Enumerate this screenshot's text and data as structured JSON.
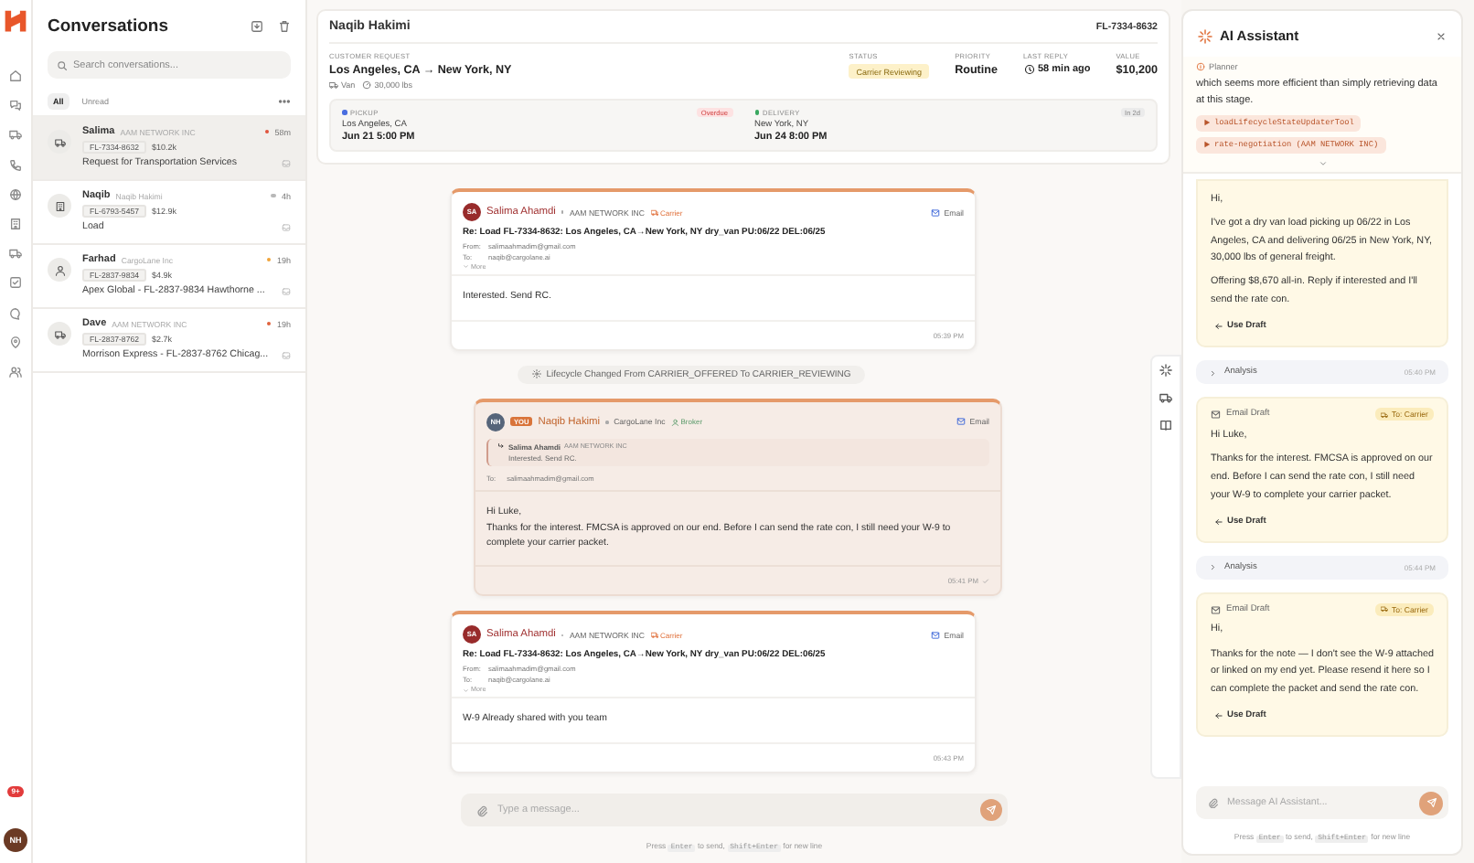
{
  "rail": {
    "badge": "9+",
    "avatar": "NH"
  },
  "conversations": {
    "title": "Conversations",
    "search": {
      "placeholder": "Search conversations..."
    },
    "filters": [
      {
        "label": "All",
        "selected": true
      },
      {
        "label": "Unread",
        "selected": false
      }
    ],
    "items": [
      {
        "kind": "truck",
        "name": "Salima",
        "company": "AAM NETWORK INC",
        "time": "58m",
        "color": "#e0533d",
        "load": "FL-7334-8632",
        "value": "$10.2k",
        "preview": "Request for Transportation Services",
        "selected": true
      },
      {
        "kind": "building",
        "name": "Naqib",
        "company": "Naqib Hakimi",
        "time": "4h",
        "color": "#b8b8b8",
        "load": "FL-6793-5457",
        "value": "$12.9k",
        "preview": "Load",
        "selected": false
      },
      {
        "kind": "person",
        "name": "Farhad",
        "company": "CargoLane Inc",
        "time": "19h",
        "color": "#f0a43a",
        "load": "FL-2837-9834",
        "value": "$4.9k",
        "preview": "Apex Global - FL-2837-9834 Hawthorne ...",
        "selected": false
      },
      {
        "kind": "truck",
        "name": "Dave",
        "company": "AAM NETWORK INC",
        "time": "19h",
        "color": "#e0633d",
        "load": "FL-2837-8762",
        "value": "$2.7k",
        "preview": "Morrison Express - FL-2837-8762 Chicag...",
        "selected": false
      }
    ]
  },
  "load": {
    "name": "Naqib Hakimi",
    "id": "FL-7334-8632",
    "request_label": "CUSTOMER REQUEST",
    "route": "Los Angeles, CA → New York, NY",
    "equipment": "Van",
    "weight": "30,000 lbs",
    "stats": [
      {
        "kind": "status",
        "label": "STATUS",
        "value": "Carrier Reviewing"
      },
      {
        "kind": "text",
        "label": "PRIORITY",
        "value": "Routine"
      },
      {
        "kind": "time",
        "label": "LAST REPLY",
        "value": "58 min ago"
      },
      {
        "kind": "text",
        "label": "VALUE",
        "value": "$10,200"
      }
    ],
    "stops": [
      {
        "kind": "pickup",
        "label": "PICKUP",
        "badge": "Overdue",
        "city": "Los Angeles, CA",
        "date": "Jun 21 5:00 PM"
      },
      {
        "kind": "delivery",
        "label": "DELIVERY",
        "badge": "In 2d",
        "city": "New York, NY",
        "date": "Jun 24 8:00 PM"
      }
    ]
  },
  "thread": [
    {
      "kind": "email",
      "own": false,
      "initials": "SA",
      "sender": "Salima Ahamdi",
      "company": "AAM NETWORK INC",
      "role": "Carrier",
      "channel": "Email",
      "subject": "Re: Load FL-7334-8632: Los Angeles, CA→New York, NY dry_van PU:06/22 DEL:06/25",
      "from_label": "From:",
      "from": "salimaahmadim@gmail.com",
      "to_label": "To:",
      "to": "naqib@cargolane.ai",
      "more": "More",
      "body": [
        "Interested. Send RC."
      ],
      "time": "05:39 PM"
    },
    {
      "kind": "event",
      "text": "Lifecycle Changed From CARRIER_OFFERED To CARRIER_REVIEWING"
    },
    {
      "kind": "email",
      "own": true,
      "you": "YOU",
      "initials": "NH",
      "sender": "Naqib Hakimi",
      "company": "CargoLane Inc",
      "role": "Broker",
      "channel": "Email",
      "quote": {
        "sender": "Salima Ahamdi",
        "company": "AAM NETWORK INC",
        "text": "Interested. Send RC."
      },
      "to_label": "To:",
      "to": "salimaahmadim@gmail.com",
      "body": [
        "Hi Luke,",
        "Thanks for the interest. FMCSA is approved on our end. Before I can send the rate con, I still need your W-9 to complete your carrier packet."
      ],
      "time": "05:41 PM"
    },
    {
      "kind": "email",
      "own": false,
      "initials": "SA",
      "sender": "Salima Ahamdi",
      "company": "AAM NETWORK INC",
      "role": "Carrier",
      "channel": "Email",
      "subject": "Re: Load FL-7334-8632: Los Angeles, CA→New York, NY dry_van PU:06/22 DEL:06/25",
      "from_label": "From:",
      "from": "salimaahmadim@gmail.com",
      "to_label": "To:",
      "to": "naqib@cargolane.ai",
      "more": "More",
      "body": [
        "W-9 Already shared with you team"
      ],
      "time": "05:43 PM"
    }
  ],
  "composer": {
    "placeholder": "Type a message...",
    "hint": [
      {
        "kind": "text",
        "text": "Press"
      },
      {
        "kind": "key",
        "text": "Enter"
      },
      {
        "kind": "text",
        "text": "to send,"
      },
      {
        "kind": "key",
        "text": "Shift+Enter"
      },
      {
        "kind": "text",
        "text": "for new line"
      }
    ]
  },
  "assistant": {
    "title": "AI Assistant",
    "planner": {
      "label": "Planner",
      "text": "which seems more efficient than simply retrieving data at this stage.",
      "tools": [
        "loadLifecycleStateUpdaterTool",
        "rate-negotiation (AAM NETWORK INC)"
      ]
    },
    "feed": [
      {
        "kind": "draft",
        "paragraphs": [
          "Hi,",
          "I've got a dry van load picking up 06/22 in Los Angeles, CA and delivering 06/25 in New York, NY, 30,000 lbs of general freight.",
          "Offering $8,670 all-in. Reply if interested and I'll send the rate con."
        ],
        "action": "Use Draft"
      },
      {
        "kind": "analysis",
        "label": "Analysis",
        "time": "05:40 PM"
      },
      {
        "kind": "draft",
        "label": "Email Draft",
        "tag": "To: Carrier",
        "paragraphs": [
          "Hi Luke,",
          "Thanks for the interest. FMCSA is approved on our end. Before I can send the rate con, I still need your W-9 to complete your carrier packet."
        ],
        "action": "Use Draft"
      },
      {
        "kind": "analysis",
        "label": "Analysis",
        "time": "05:44 PM"
      },
      {
        "kind": "draft",
        "label": "Email Draft",
        "tag": "To: Carrier",
        "paragraphs": [
          "Hi,",
          "Thanks for the note — I don't see the W-9 attached or linked on my end yet. Please resend it here so I can complete the packet and send the rate con."
        ],
        "action": "Use Draft"
      }
    ],
    "composer": {
      "placeholder": "Message AI Assistant...",
      "hint": [
        {
          "kind": "text",
          "text": "Press"
        },
        {
          "kind": "key",
          "text": "Enter"
        },
        {
          "kind": "text",
          "text": "to send,"
        },
        {
          "kind": "key",
          "text": "Shift+Enter"
        },
        {
          "kind": "text",
          "text": "for new line"
        }
      ]
    }
  }
}
